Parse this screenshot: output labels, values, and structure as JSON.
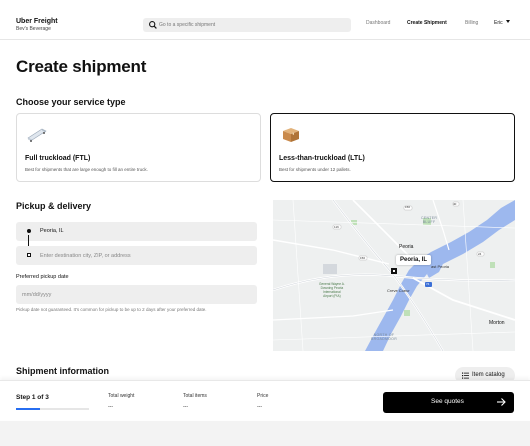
{
  "header": {
    "brand_name": "Uber Freight",
    "org_name": "Bev's Beverage",
    "search_placeholder": "Go to a specific shipment",
    "nav": [
      "Dashboard",
      "Create Shipment",
      "Billing"
    ],
    "active_nav": "Create Shipment",
    "user": "Eric"
  },
  "page": {
    "title": "Create shipment",
    "service_title": "Choose your service type",
    "pickup_title": "Pickup & delivery",
    "shipment_info_title": "Shipment information"
  },
  "service_cards": [
    {
      "title": "Full truckload (FTL)",
      "desc": "Best for shipments that are large enough to fill an entire truck.",
      "icon": "truck-trailer-icon",
      "selected": false
    },
    {
      "title": "Less-than-truckload (LTL)",
      "desc": "Best for shipments under 12 pallets.",
      "icon": "cardboard-box-icon",
      "selected": true
    }
  ],
  "pickup": {
    "origin_value": "Peoria, IL",
    "destination_placeholder": "Enter destination city, ZIP, or address",
    "date_label": "Preferred pickup date",
    "date_placeholder": "mm/dd/yyyy",
    "note": "Pickup date not guaranteed. It's common for pickup to be up to 2 days after your preferred date."
  },
  "map": {
    "pin_label": "Peoria, IL",
    "labels": {
      "center_bluff": "CENTER\nBLUFF",
      "peoria": "Peoria",
      "east_peoria": "ast Peoria",
      "creve_coeur": "Creve Coeur",
      "airport": "General Wayne A.\nDowning Peoria\nInternational\nAirport (PIA)",
      "morton": "Morton",
      "north_broadmoor": "NORTH OF\nBROADMOOR"
    },
    "route_shields": [
      "150",
      "40",
      "150",
      "24",
      "74",
      "116"
    ],
    "colors": {
      "water": "#9db8ee",
      "road": "#ffffff",
      "park": "#bfe0b8",
      "land": "#eef0f0"
    }
  },
  "item_catalog_label": "Item catalog",
  "footer": {
    "step": "Step 1 of 3",
    "progress": 0.33,
    "progress_color": "#276ef1",
    "stats": [
      {
        "label": "Total weight",
        "value": "---"
      },
      {
        "label": "Total items",
        "value": "---"
      },
      {
        "label": "Price",
        "value": "---"
      }
    ],
    "cta": "See quotes"
  }
}
